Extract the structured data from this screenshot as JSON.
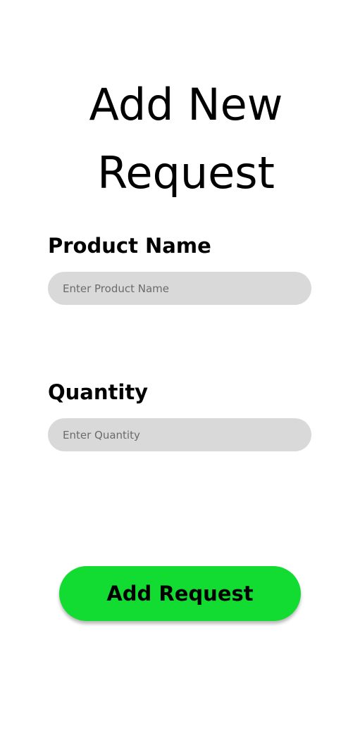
{
  "page": {
    "title_line1": "Add New",
    "title_line2": "Request"
  },
  "form": {
    "product_name": {
      "label": "Product Name",
      "placeholder": "Enter Product Name",
      "value": ""
    },
    "quantity": {
      "label": "Quantity",
      "placeholder": "Enter Quantity",
      "value": ""
    },
    "submit_label": "Add Request"
  },
  "colors": {
    "background": "#ffffff",
    "input_background": "#d9d9d9",
    "button_green": "#12dc31",
    "text": "#000000"
  }
}
